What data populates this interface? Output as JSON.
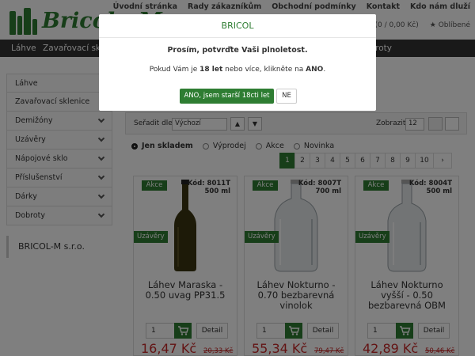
{
  "header": {
    "brand": "Bricol - M",
    "top_links": [
      "Úvodní stránka",
      "Rady zákazníkům",
      "Obchodní podmínky",
      "Kontakt",
      "Kdo nám dluží"
    ],
    "cart_text": "(0 / 0,00 Kč)",
    "favorites": "Oblíbené"
  },
  "nav": {
    "items": [
      "Láhve",
      "Zavařovací skle",
      "Dobroty"
    ]
  },
  "sidebar": {
    "items": [
      {
        "label": "Láhve",
        "has_chevron": false
      },
      {
        "label": "Zavařovací sklenice",
        "has_chevron": false
      },
      {
        "label": "Demižóny",
        "has_chevron": true
      },
      {
        "label": "Uzávěry",
        "has_chevron": true
      },
      {
        "label": "Nápojové sklo",
        "has_chevron": true
      },
      {
        "label": "Příslušenství",
        "has_chevron": true
      },
      {
        "label": "Dárky",
        "has_chevron": true
      },
      {
        "label": "Dobroty",
        "has_chevron": true
      }
    ],
    "company": "BRICOL-M s.r.o."
  },
  "sorting": {
    "sort_label": "Seřadit dle",
    "sort_value": "Výchozí",
    "show_label": "Zobrazit",
    "show_value": "12"
  },
  "filters": [
    {
      "label": "Jen skladem",
      "selected": true
    },
    {
      "label": "Výprodej",
      "selected": false
    },
    {
      "label": "Akce",
      "selected": false
    },
    {
      "label": "Novinka",
      "selected": false
    }
  ],
  "pagination": {
    "pages": [
      "1",
      "2",
      "3",
      "4",
      "5",
      "6",
      "7",
      "8",
      "9",
      "10"
    ],
    "current": "1",
    "next": "›"
  },
  "products": [
    {
      "badge": "Akce",
      "code": "Kód: 8011T",
      "volume": "500 ml",
      "category": "Uzávěry",
      "name": "Láhev Maraska - 0.50 uvag PP31.5",
      "qty": "1",
      "detail": "Detail",
      "price": "16,47 Kč",
      "old_price": "20,33 Kč",
      "bottle": "brown"
    },
    {
      "badge": "Akce",
      "code": "Kód: 8007T",
      "volume": "700 ml",
      "category": "Uzávěry",
      "name": "Láhev Nokturno - 0.70 bezbarevná vinolok",
      "qty": "1",
      "detail": "Detail",
      "price": "55,34 Kč",
      "old_price": "79,47 Kč",
      "bottle": "clear"
    },
    {
      "badge": "Akce",
      "code": "Kód: 8004T",
      "volume": "500 ml",
      "category": "Uzávěry",
      "name": "Láhev Nokturno vyšší - 0.50 bezbarevná OBM",
      "qty": "1",
      "detail": "Detail",
      "price": "42,89 Kč",
      "old_price": "50,46 Kč",
      "bottle": "clear-tall"
    }
  ],
  "modal": {
    "title": "BRICOL",
    "question": "Prosím, potvrďte Vaši plnoletost.",
    "text_before": "Pokud Vám je ",
    "age": "18 let",
    "text_mid": " nebo více, klikněte na ",
    "yes_word": "ANO",
    "text_end": ".",
    "yes_button": "ANO, jsem starší 18cti let",
    "no_button": "NE"
  },
  "colors": {
    "accent": "#2e7d32",
    "price": "#c62828",
    "nav_bg": "#333333"
  }
}
